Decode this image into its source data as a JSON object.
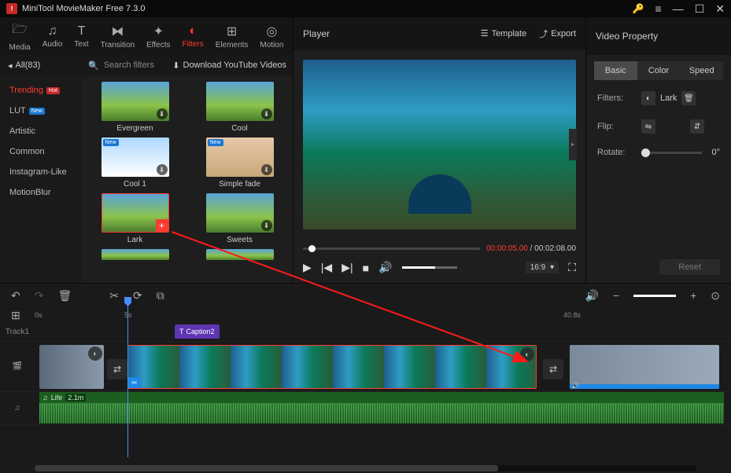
{
  "titlebar": {
    "title": "MiniTool MovieMaker Free 7.3.0"
  },
  "tabs": [
    {
      "label": "Media"
    },
    {
      "label": "Audio"
    },
    {
      "label": "Text"
    },
    {
      "label": "Transition"
    },
    {
      "label": "Effects"
    },
    {
      "label": "Filters"
    },
    {
      "label": "Elements"
    },
    {
      "label": "Motion"
    }
  ],
  "filter_header": {
    "all": "All(83)",
    "search_placeholder": "Search filters",
    "download": "Download YouTube Videos"
  },
  "categories": [
    {
      "label": "Trending",
      "badge": "Hot",
      "badge_class": "badge-hot"
    },
    {
      "label": "LUT",
      "badge": "New",
      "badge_class": "badge-new"
    },
    {
      "label": "Artistic"
    },
    {
      "label": "Common"
    },
    {
      "label": "Instagram-Like"
    },
    {
      "label": "MotionBlur"
    }
  ],
  "filters_grid": [
    {
      "label": "Evergreen"
    },
    {
      "label": "Cool"
    },
    {
      "label": "Cool 1"
    },
    {
      "label": "Simple fade"
    },
    {
      "label": "Lark",
      "selected": true
    },
    {
      "label": "Sweets"
    }
  ],
  "player": {
    "title": "Player",
    "template": "Template",
    "export": "Export",
    "time_current": "00:00:05.00",
    "time_total": "00:02:08.00",
    "aspect": "16:9"
  },
  "props": {
    "title": "Video Property",
    "tabs": {
      "basic": "Basic",
      "color": "Color",
      "speed": "Speed"
    },
    "filters_label": "Filters:",
    "filter_name": "Lark",
    "flip_label": "Flip:",
    "rotate_label": "Rotate:",
    "rotate_value": "0°",
    "reset": "Reset"
  },
  "timeline": {
    "ruler": {
      "m0": "0s",
      "m1": "5s",
      "m2": "40.8s"
    },
    "track1_label": "Track1",
    "caption_label": "Caption2",
    "audio_name": "Life",
    "audio_dur": "2.1m"
  }
}
